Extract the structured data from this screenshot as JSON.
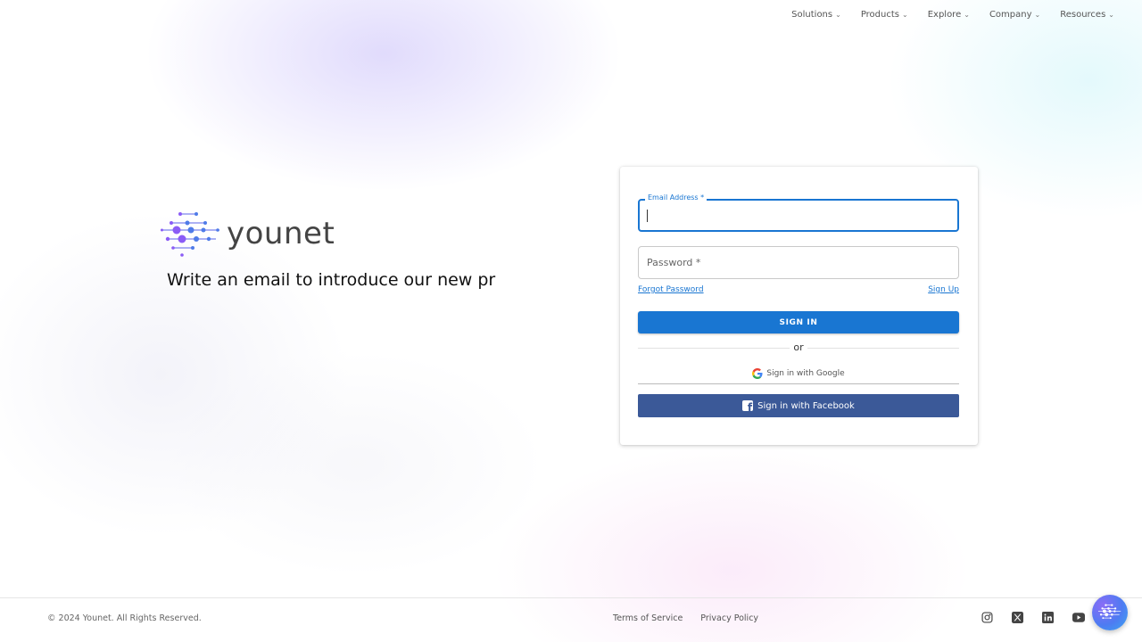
{
  "nav": {
    "items": [
      {
        "label": "Solutions",
        "chevron": "⌄"
      },
      {
        "label": "Products",
        "chevron": "⌄"
      },
      {
        "label": "Explore",
        "chevron": "⌄"
      },
      {
        "label": "Company",
        "chevron": "⌄"
      },
      {
        "label": "Resources",
        "chevron": "⌄"
      }
    ]
  },
  "brand": {
    "name": "younet",
    "tagline": "Write an email to introduce our new pr"
  },
  "login": {
    "email_label": "Email Address *",
    "email_value": "",
    "password_label": "Password *",
    "forgot_password": "Forgot Password",
    "sign_up": "Sign Up",
    "sign_in_button": "SIGN IN",
    "or_text": "or",
    "google_button": "Sign in with Google",
    "facebook_button": "Sign in with Facebook"
  },
  "footer": {
    "copyright": "© 2024 Younet. All Rights Reserved.",
    "links": [
      "Terms of Service",
      "Privacy Policy"
    ],
    "socials": [
      "instagram-icon",
      "x-icon",
      "linkedin-icon",
      "youtube-icon"
    ]
  },
  "colors": {
    "primary": "#1976d2",
    "facebook": "#3b5998",
    "logo_purple": "#8b5cf6",
    "logo_blue": "#3b82f6"
  }
}
